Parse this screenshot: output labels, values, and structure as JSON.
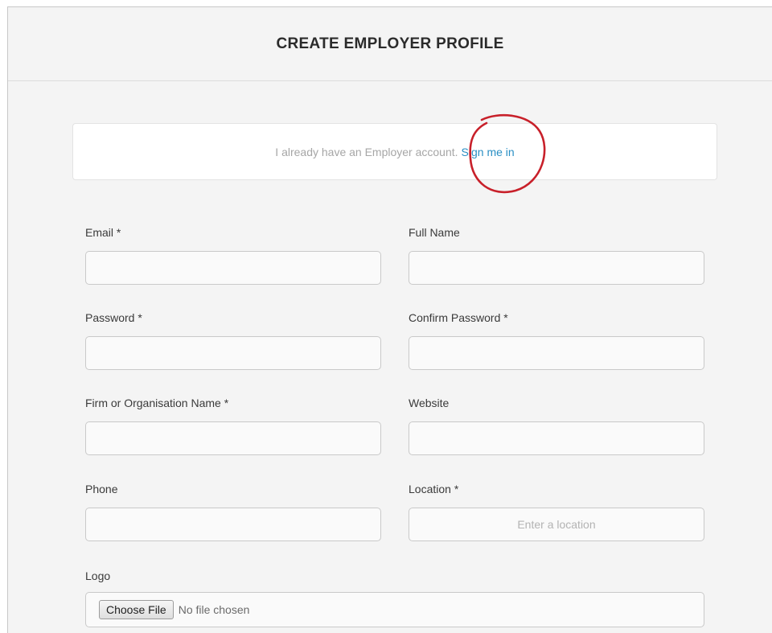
{
  "header": {
    "title": "CREATE EMPLOYER PROFILE"
  },
  "signin": {
    "prompt": "I already have an Employer account.",
    "link_label": "Sign me in",
    "annotation_color": "#c8202a"
  },
  "form": {
    "email": {
      "label": "Email *",
      "value": "",
      "placeholder": ""
    },
    "full_name": {
      "label": "Full Name",
      "value": "",
      "placeholder": ""
    },
    "password": {
      "label": "Password *",
      "value": "",
      "placeholder": ""
    },
    "confirm_password": {
      "label": "Confirm Password *",
      "value": "",
      "placeholder": ""
    },
    "firm_name": {
      "label": "Firm or Organisation Name *",
      "value": "",
      "placeholder": ""
    },
    "website": {
      "label": "Website",
      "value": "",
      "placeholder": ""
    },
    "phone": {
      "label": "Phone",
      "value": "",
      "placeholder": ""
    },
    "location": {
      "label": "Location *",
      "value": "",
      "placeholder": "Enter a location"
    },
    "logo": {
      "label": "Logo",
      "button_label": "Choose File",
      "status": "No file chosen"
    }
  },
  "colors": {
    "link": "#2a8fc4",
    "page_background": "#f4f4f4",
    "annotation": "#c8202a"
  }
}
